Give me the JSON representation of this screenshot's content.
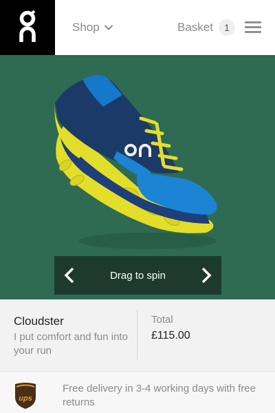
{
  "header": {
    "brand_icon": "on-logo-icon",
    "shop_label": "Shop",
    "basket_label": "Basket",
    "basket_count": "1",
    "menu_icon": "hamburger-menu-icon"
  },
  "hero": {
    "background_color": "#2f6a52",
    "image": "cloudster-shoe-blue-yellow",
    "spin_label": "Drag to spin"
  },
  "product": {
    "name": "Cloudster",
    "tagline": "I put comfort and fun into your run",
    "total_label": "Total",
    "price": "£115.00"
  },
  "delivery": {
    "icon": "ups-shield-icon",
    "text": "Free delivery in 3-4 working days with free returns"
  }
}
